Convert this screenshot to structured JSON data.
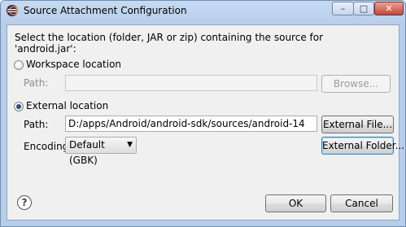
{
  "window": {
    "title": "Source Attachment Configuration",
    "minimize_glyph": "–",
    "maximize_glyph": "□",
    "close_glyph": "✕"
  },
  "dialog": {
    "instruction_line1": "Select the location (folder, JAR or zip) containing the source for",
    "instruction_line2": "'android.jar':",
    "workspace": {
      "radio_label": "Workspace location",
      "selected": false,
      "path_label": "Path:",
      "path_value": "",
      "browse_button": "Browse..."
    },
    "external": {
      "radio_label": "External location",
      "selected": true,
      "path_label": "Path:",
      "path_value": "D:/apps/Android/android-sdk/sources/android-14",
      "external_file_button": "External File...",
      "encoding_label": "Encoding:",
      "encoding_value": "Default (GBK)",
      "external_folder_button": "External Folder..."
    },
    "help_glyph": "?",
    "ok_button": "OK",
    "cancel_button": "Cancel"
  }
}
